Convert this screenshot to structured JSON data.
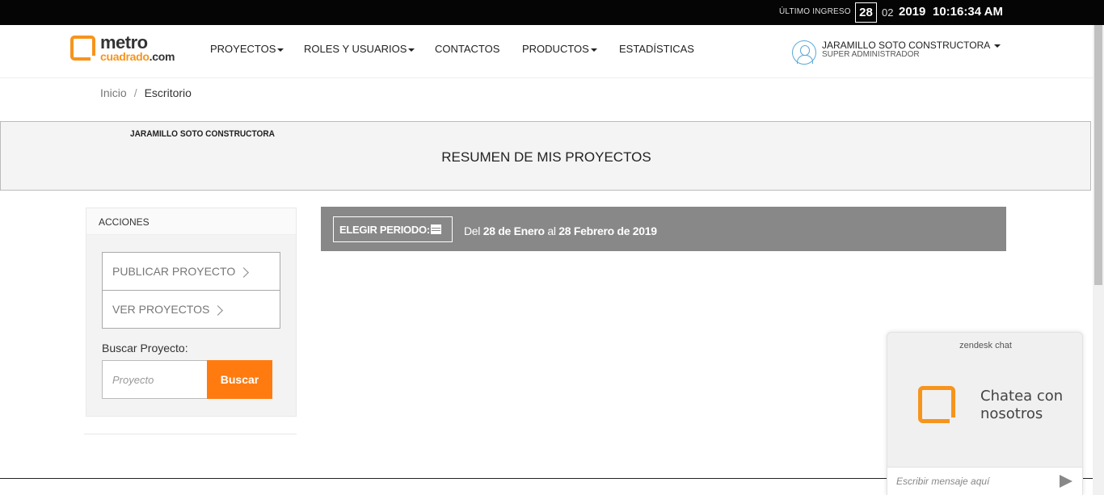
{
  "topbar": {
    "last_login_label": "ÚLTIMO INGRESO",
    "day": "28",
    "month": "02",
    "year": "2019",
    "time": "10:16:34 AM"
  },
  "logo": {
    "line1": "metro",
    "line2": "cuadrado",
    "domain": ".com",
    "brand_color": "#f7941d"
  },
  "nav": {
    "items": [
      {
        "label": "PROYECTOS",
        "dropdown": true
      },
      {
        "label": "ROLES Y USUARIOS",
        "dropdown": true
      },
      {
        "label": "CONTACTOS",
        "dropdown": false
      },
      {
        "label": "PRODUCTOS",
        "dropdown": true
      },
      {
        "label": "ESTADÍSTICAS",
        "dropdown": false
      }
    ]
  },
  "user": {
    "name": "JARAMILLO SOTO CONSTRUCTORA",
    "role": "SUPER ADMINISTRADOR"
  },
  "breadcrumb": {
    "home": "Inicio",
    "separator": "/",
    "current": "Escritorio"
  },
  "banner": {
    "company": "JARAMILLO SOTO CONSTRUCTORA",
    "title": "RESUMEN DE MIS PROYECTOS"
  },
  "actions": {
    "header": "ACCIONES",
    "publish_label": "PUBLICAR PROYECTO",
    "view_label": "VER PROYECTOS",
    "search_label": "Buscar Proyecto:",
    "search_placeholder": "Proyecto",
    "search_button": "Buscar",
    "accent_color": "#ff7b0f"
  },
  "period": {
    "button_label": "ELEGIR PERIODO:",
    "prefix": "Del",
    "from": "28 de Enero",
    "connector": "al",
    "to": "28 Febrero de 2019"
  },
  "chat": {
    "brand": "zendesk chat",
    "line1": "Chatea con",
    "line2": "nosotros",
    "input_placeholder": "Escribir mensaje aquí"
  }
}
